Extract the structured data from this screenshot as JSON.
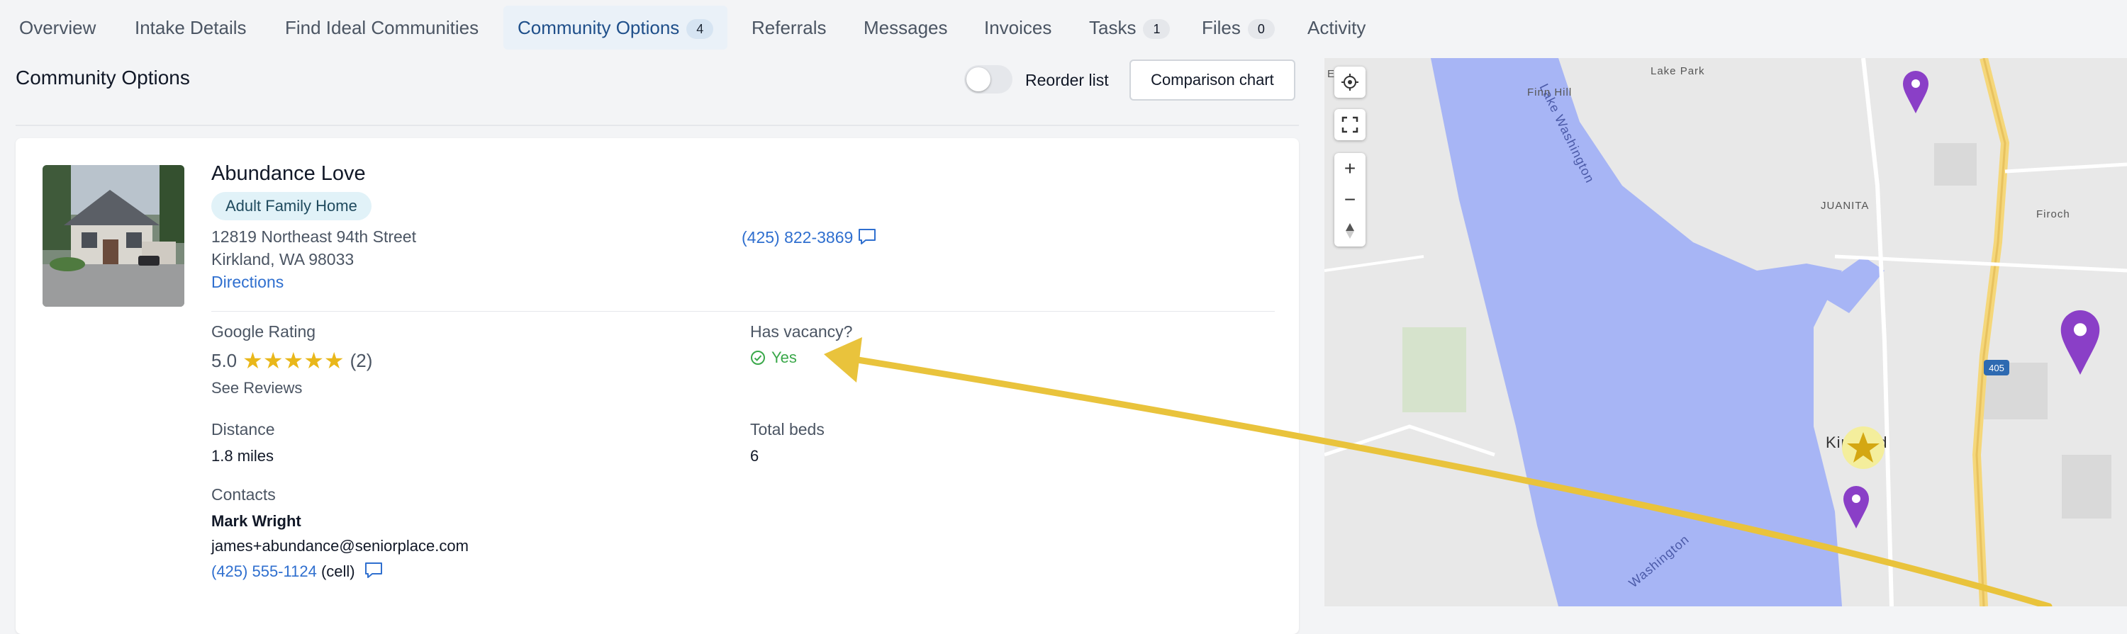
{
  "tabs": [
    {
      "label": "Overview"
    },
    {
      "label": "Intake Details"
    },
    {
      "label": "Find Ideal Communities"
    },
    {
      "label": "Community Options",
      "count": "4"
    },
    {
      "label": "Referrals"
    },
    {
      "label": "Messages"
    },
    {
      "label": "Invoices"
    },
    {
      "label": "Tasks",
      "count": "1"
    },
    {
      "label": "Files",
      "count": "0"
    },
    {
      "label": "Activity"
    }
  ],
  "header": {
    "title": "Community Options",
    "reorder_label": "Reorder list",
    "reorder_on": false,
    "comparison_label": "Comparison chart"
  },
  "community": {
    "name": "Abundance Love",
    "type": "Adult Family Home",
    "address_line1": "12819 Northeast 94th Street",
    "address_line2": "Kirkland, WA 98033",
    "directions": "Directions",
    "phone": "(425) 822-3869",
    "google_rating_label": "Google Rating",
    "rating": "5.0",
    "stars": 5,
    "review_count": "(2)",
    "see_reviews": "See Reviews",
    "vacancy_label": "Has vacancy?",
    "vacancy_value": "Yes",
    "distance_label": "Distance",
    "distance_value": "1.8 miles",
    "beds_label": "Total beds",
    "beds_value": "6",
    "contacts_label": "Contacts",
    "contact_name": "Mark Wright",
    "contact_email": "james+abundance@seniorplace.com",
    "contact_phone": "(425) 555-1124",
    "contact_phone_type": "(cell)"
  },
  "map": {
    "labels": {
      "lake_park": "Lake Park",
      "finn_hill": "Finn Hill",
      "juanita": "JUANITA",
      "finch": "Firoch",
      "lake_washington": "Lake Washington",
      "lake_washington_south": "Washington",
      "kirkland": "Kirkland",
      "highway": "405",
      "e_label": "E"
    },
    "colors": {
      "water": "#a7b5f5",
      "land": "#e8e8e8",
      "pin": "#8a3fc7",
      "star": "#e9b71a",
      "road": "#f5d77a",
      "arrow": "#e9c33c"
    },
    "icons": [
      "locate-icon",
      "fullscreen-icon",
      "zoom-in-icon",
      "zoom-out-icon",
      "compass-icon",
      "map-pin-icon",
      "star-marker-icon"
    ]
  },
  "annotation": {
    "arrow_color": "#e9c33c"
  }
}
